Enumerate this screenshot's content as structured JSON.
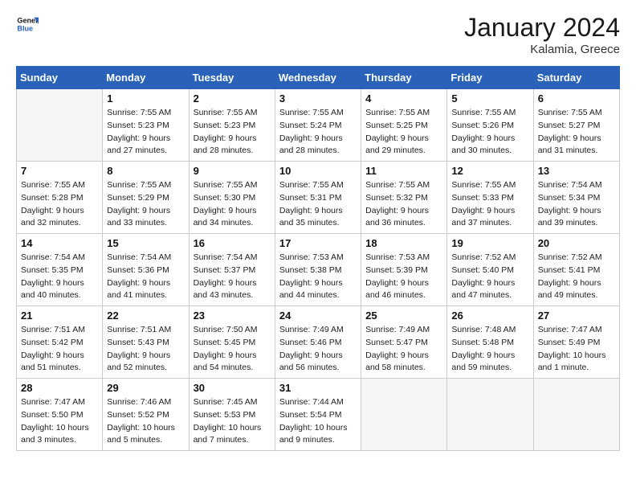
{
  "header": {
    "logo_line1": "General",
    "logo_line2": "Blue",
    "month_title": "January 2024",
    "location": "Kalamia, Greece"
  },
  "days_of_week": [
    "Sunday",
    "Monday",
    "Tuesday",
    "Wednesday",
    "Thursday",
    "Friday",
    "Saturday"
  ],
  "weeks": [
    [
      {
        "day": "",
        "sunrise": "",
        "sunset": "",
        "daylight": ""
      },
      {
        "day": "1",
        "sunrise": "Sunrise: 7:55 AM",
        "sunset": "Sunset: 5:23 PM",
        "daylight": "Daylight: 9 hours and 27 minutes."
      },
      {
        "day": "2",
        "sunrise": "Sunrise: 7:55 AM",
        "sunset": "Sunset: 5:23 PM",
        "daylight": "Daylight: 9 hours and 28 minutes."
      },
      {
        "day": "3",
        "sunrise": "Sunrise: 7:55 AM",
        "sunset": "Sunset: 5:24 PM",
        "daylight": "Daylight: 9 hours and 28 minutes."
      },
      {
        "day": "4",
        "sunrise": "Sunrise: 7:55 AM",
        "sunset": "Sunset: 5:25 PM",
        "daylight": "Daylight: 9 hours and 29 minutes."
      },
      {
        "day": "5",
        "sunrise": "Sunrise: 7:55 AM",
        "sunset": "Sunset: 5:26 PM",
        "daylight": "Daylight: 9 hours and 30 minutes."
      },
      {
        "day": "6",
        "sunrise": "Sunrise: 7:55 AM",
        "sunset": "Sunset: 5:27 PM",
        "daylight": "Daylight: 9 hours and 31 minutes."
      }
    ],
    [
      {
        "day": "7",
        "sunrise": "Sunrise: 7:55 AM",
        "sunset": "Sunset: 5:28 PM",
        "daylight": "Daylight: 9 hours and 32 minutes."
      },
      {
        "day": "8",
        "sunrise": "Sunrise: 7:55 AM",
        "sunset": "Sunset: 5:29 PM",
        "daylight": "Daylight: 9 hours and 33 minutes."
      },
      {
        "day": "9",
        "sunrise": "Sunrise: 7:55 AM",
        "sunset": "Sunset: 5:30 PM",
        "daylight": "Daylight: 9 hours and 34 minutes."
      },
      {
        "day": "10",
        "sunrise": "Sunrise: 7:55 AM",
        "sunset": "Sunset: 5:31 PM",
        "daylight": "Daylight: 9 hours and 35 minutes."
      },
      {
        "day": "11",
        "sunrise": "Sunrise: 7:55 AM",
        "sunset": "Sunset: 5:32 PM",
        "daylight": "Daylight: 9 hours and 36 minutes."
      },
      {
        "day": "12",
        "sunrise": "Sunrise: 7:55 AM",
        "sunset": "Sunset: 5:33 PM",
        "daylight": "Daylight: 9 hours and 37 minutes."
      },
      {
        "day": "13",
        "sunrise": "Sunrise: 7:54 AM",
        "sunset": "Sunset: 5:34 PM",
        "daylight": "Daylight: 9 hours and 39 minutes."
      }
    ],
    [
      {
        "day": "14",
        "sunrise": "Sunrise: 7:54 AM",
        "sunset": "Sunset: 5:35 PM",
        "daylight": "Daylight: 9 hours and 40 minutes."
      },
      {
        "day": "15",
        "sunrise": "Sunrise: 7:54 AM",
        "sunset": "Sunset: 5:36 PM",
        "daylight": "Daylight: 9 hours and 41 minutes."
      },
      {
        "day": "16",
        "sunrise": "Sunrise: 7:54 AM",
        "sunset": "Sunset: 5:37 PM",
        "daylight": "Daylight: 9 hours and 43 minutes."
      },
      {
        "day": "17",
        "sunrise": "Sunrise: 7:53 AM",
        "sunset": "Sunset: 5:38 PM",
        "daylight": "Daylight: 9 hours and 44 minutes."
      },
      {
        "day": "18",
        "sunrise": "Sunrise: 7:53 AM",
        "sunset": "Sunset: 5:39 PM",
        "daylight": "Daylight: 9 hours and 46 minutes."
      },
      {
        "day": "19",
        "sunrise": "Sunrise: 7:52 AM",
        "sunset": "Sunset: 5:40 PM",
        "daylight": "Daylight: 9 hours and 47 minutes."
      },
      {
        "day": "20",
        "sunrise": "Sunrise: 7:52 AM",
        "sunset": "Sunset: 5:41 PM",
        "daylight": "Daylight: 9 hours and 49 minutes."
      }
    ],
    [
      {
        "day": "21",
        "sunrise": "Sunrise: 7:51 AM",
        "sunset": "Sunset: 5:42 PM",
        "daylight": "Daylight: 9 hours and 51 minutes."
      },
      {
        "day": "22",
        "sunrise": "Sunrise: 7:51 AM",
        "sunset": "Sunset: 5:43 PM",
        "daylight": "Daylight: 9 hours and 52 minutes."
      },
      {
        "day": "23",
        "sunrise": "Sunrise: 7:50 AM",
        "sunset": "Sunset: 5:45 PM",
        "daylight": "Daylight: 9 hours and 54 minutes."
      },
      {
        "day": "24",
        "sunrise": "Sunrise: 7:49 AM",
        "sunset": "Sunset: 5:46 PM",
        "daylight": "Daylight: 9 hours and 56 minutes."
      },
      {
        "day": "25",
        "sunrise": "Sunrise: 7:49 AM",
        "sunset": "Sunset: 5:47 PM",
        "daylight": "Daylight: 9 hours and 58 minutes."
      },
      {
        "day": "26",
        "sunrise": "Sunrise: 7:48 AM",
        "sunset": "Sunset: 5:48 PM",
        "daylight": "Daylight: 9 hours and 59 minutes."
      },
      {
        "day": "27",
        "sunrise": "Sunrise: 7:47 AM",
        "sunset": "Sunset: 5:49 PM",
        "daylight": "Daylight: 10 hours and 1 minute."
      }
    ],
    [
      {
        "day": "28",
        "sunrise": "Sunrise: 7:47 AM",
        "sunset": "Sunset: 5:50 PM",
        "daylight": "Daylight: 10 hours and 3 minutes."
      },
      {
        "day": "29",
        "sunrise": "Sunrise: 7:46 AM",
        "sunset": "Sunset: 5:52 PM",
        "daylight": "Daylight: 10 hours and 5 minutes."
      },
      {
        "day": "30",
        "sunrise": "Sunrise: 7:45 AM",
        "sunset": "Sunset: 5:53 PM",
        "daylight": "Daylight: 10 hours and 7 minutes."
      },
      {
        "day": "31",
        "sunrise": "Sunrise: 7:44 AM",
        "sunset": "Sunset: 5:54 PM",
        "daylight": "Daylight: 10 hours and 9 minutes."
      },
      {
        "day": "",
        "sunrise": "",
        "sunset": "",
        "daylight": ""
      },
      {
        "day": "",
        "sunrise": "",
        "sunset": "",
        "daylight": ""
      },
      {
        "day": "",
        "sunrise": "",
        "sunset": "",
        "daylight": ""
      }
    ]
  ]
}
